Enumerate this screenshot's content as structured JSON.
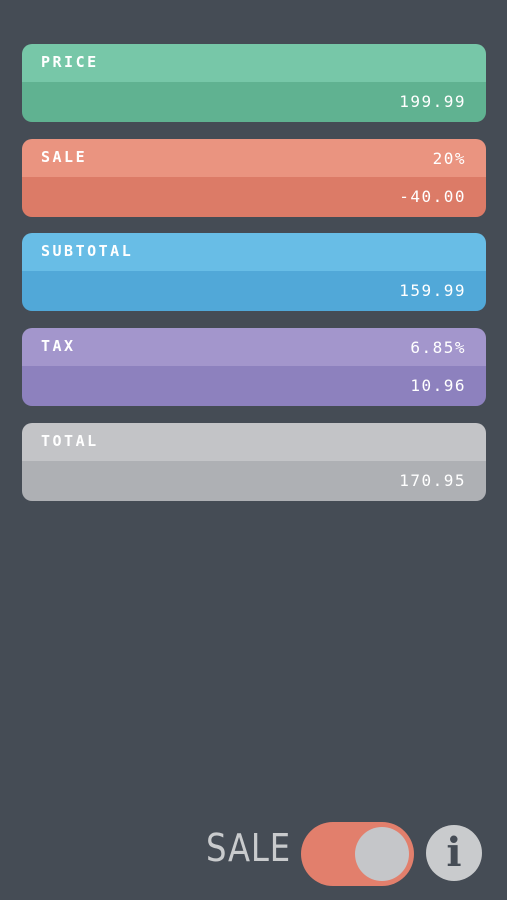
{
  "cards": {
    "price": {
      "label": "PRICE",
      "value": "199.99"
    },
    "sale": {
      "label": "SALE",
      "rate": "20%",
      "value": "-40.00"
    },
    "subtotal": {
      "label": "SUBTOTAL",
      "value": "159.99"
    },
    "tax": {
      "label": "TAX",
      "rate": "6.85%",
      "value": "10.96"
    },
    "total": {
      "label": "TOTAL",
      "value": "170.95"
    }
  },
  "footer": {
    "sale_label": "SALE",
    "toggle_on": true,
    "info_glyph": "i"
  },
  "colors": {
    "background": "#454c55",
    "price": "#77c7a8",
    "sale": "#ea9480",
    "subtotal": "#68bde6",
    "tax": "#a396cc",
    "total": "#c3c4c7",
    "toggle": "#e27f6c"
  },
  "icons": {
    "info": "info-icon"
  }
}
